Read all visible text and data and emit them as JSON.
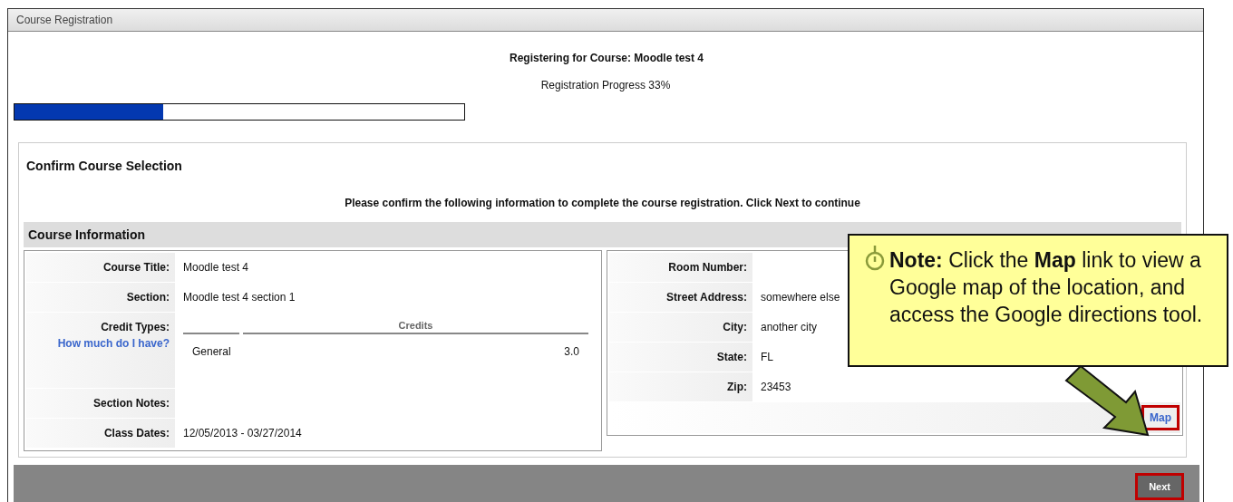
{
  "window": {
    "title": "Course Registration"
  },
  "heading": "Registering for Course: Moodle test 4",
  "progress": {
    "label": "Registration Progress 33%",
    "level": 0.33
  },
  "section_title": "Confirm Course Selection",
  "instructions": "Please confirm the following information to complete the course registration. Click Next to continue",
  "panel_title": "Course Information",
  "left_fields": [
    {
      "kind": "text",
      "label": "Course Title:",
      "value": "Moodle test 4"
    },
    {
      "kind": "text",
      "label": "Section:",
      "value": "Moodle test 4 section 1"
    },
    {
      "kind": "credits",
      "label": "Credit Types:",
      "link": "How much do I have?",
      "column": "Credits",
      "rows": [
        {
          "type": "General",
          "credits": "3.0"
        }
      ]
    },
    {
      "kind": "text",
      "label": "Section Notes:"
    },
    {
      "kind": "text",
      "label": "Class Dates:",
      "value": "12/05/2013 - 03/27/2014"
    }
  ],
  "right_fields": [
    {
      "label": "Room Number:"
    },
    {
      "label": "Street Address:",
      "value": "somewhere else"
    },
    {
      "label": "City:",
      "value": "another city"
    },
    {
      "label": "State:",
      "value": "FL"
    },
    {
      "label": "Zip:",
      "value": "23453"
    }
  ],
  "map_link": {
    "label": "Map",
    "highlighted": true
  },
  "next_button": {
    "label": "Next",
    "highlighted": true
  },
  "callout": {
    "text": "**Note:** Click the **Map** link to view a Google map of the location, and access the Google directions tool."
  }
}
